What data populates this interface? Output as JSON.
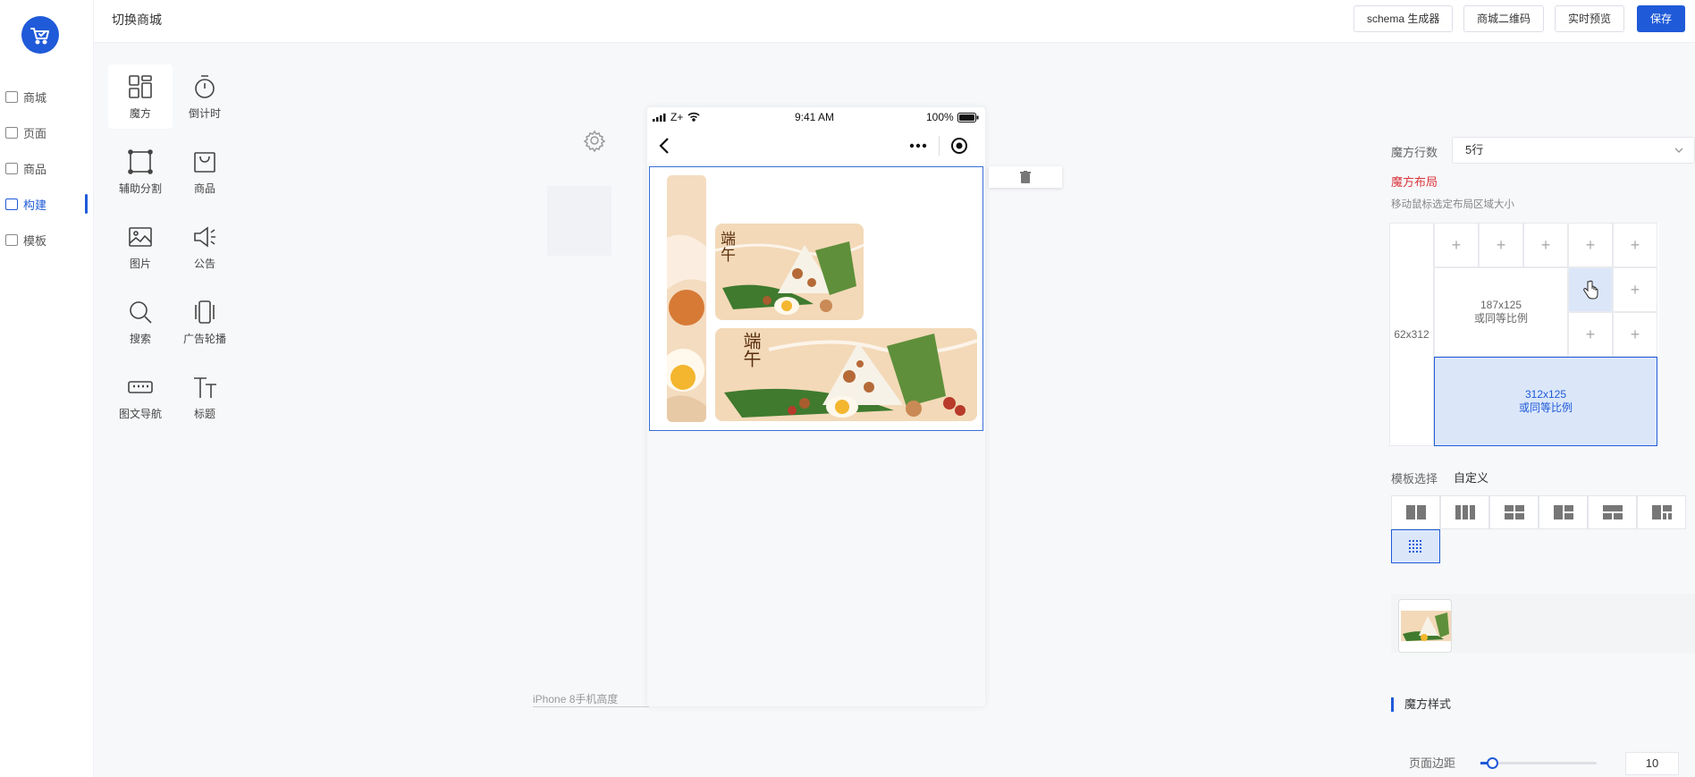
{
  "nav": {
    "items": [
      {
        "label": "商城",
        "icon": "shop-icon"
      },
      {
        "label": "页面",
        "icon": "page-icon"
      },
      {
        "label": "商品",
        "icon": "goods-icon"
      },
      {
        "label": "构建",
        "icon": "build-icon",
        "active": true
      },
      {
        "label": "模板",
        "icon": "template-icon"
      }
    ]
  },
  "topbar": {
    "switch_label": "切换商城",
    "schema_label": "schema 生成器",
    "qrcode_label": "商城二维码",
    "preview_label": "实时预览",
    "save_label": "保存"
  },
  "components": [
    {
      "label": "魔方",
      "icon": "magic-cube-icon"
    },
    {
      "label": "倒计时",
      "icon": "countdown-icon"
    },
    {
      "label": "辅助分割",
      "icon": "divider-icon"
    },
    {
      "label": "商品",
      "icon": "shopping-bag-icon"
    },
    {
      "label": "图片",
      "icon": "image-icon"
    },
    {
      "label": "公告",
      "icon": "announcement-icon"
    },
    {
      "label": "搜索",
      "icon": "search-icon"
    },
    {
      "label": "广告轮播",
      "icon": "carousel-icon"
    },
    {
      "label": "图文导航",
      "icon": "keyboard-nav-icon"
    },
    {
      "label": "标题",
      "icon": "title-icon"
    }
  ],
  "phone": {
    "carrier": "Z+",
    "time": "9:41 AM",
    "battery": "100%",
    "height_hint": "iPhone 8手机高度",
    "banner_text": "端午"
  },
  "settings": {
    "rows_label": "魔方行数",
    "rows_value": "5行",
    "layout_title": "魔方布局",
    "layout_hint": "移动鼠标选定布局区域大小",
    "block_left": "62x312",
    "block_middle_size": "187x125",
    "block_middle_ratio": "或同等比例",
    "block_bottom_size": "312x125",
    "block_bottom_ratio": "或同等比例",
    "plus": "+",
    "template_label": "模板选择",
    "template_value": "自定义",
    "style_title": "魔方样式",
    "margin_label": "页面边距",
    "margin_value": "10",
    "margin_fraction": 0.1,
    "accent_color": "#1f5ad8",
    "alert_color": "#d9363e"
  }
}
